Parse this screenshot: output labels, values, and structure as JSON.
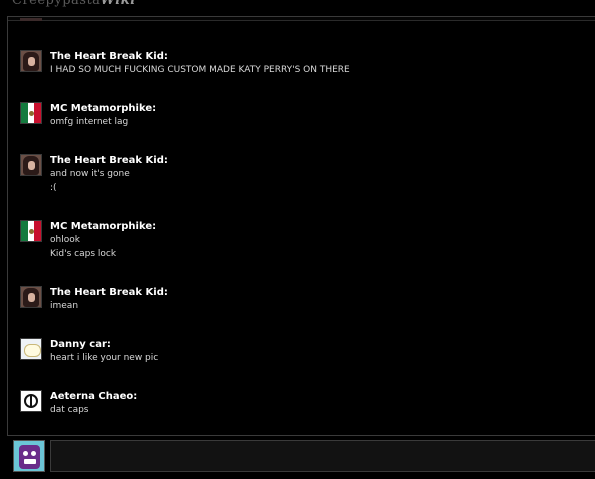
{
  "header": {
    "logo_prefix": "Creepypasta",
    "logo_suffix": "Wiki"
  },
  "chat": {
    "messages": [
      {
        "user": "The Heart Break Kid:",
        "avatar": "woman-photo-avatar",
        "lines": [
          "I HAD SO MUCH FUCKING CUSTOM MADE KATY PERRY'S ON THERE"
        ]
      },
      {
        "user": "MC Metamorphike:",
        "avatar": "mexico-flag-avatar",
        "lines": [
          "omfg internet lag"
        ]
      },
      {
        "user": "The Heart Break Kid:",
        "avatar": "woman-photo-avatar",
        "lines": [
          "and now it's gone",
          ":("
        ]
      },
      {
        "user": "MC Metamorphike:",
        "avatar": "mexico-flag-avatar",
        "lines": [
          "ohlook",
          "Kid's caps lock"
        ]
      },
      {
        "user": "The Heart Break Kid:",
        "avatar": "woman-photo-avatar",
        "lines": [
          "imean"
        ]
      },
      {
        "user": "Danny car:",
        "avatar": "cartoon-blob-avatar",
        "lines": [
          "heart i like your new pic"
        ]
      },
      {
        "user": "Aeterna Chaeo:",
        "avatar": "clock-symbol-avatar",
        "lines": [
          "dat caps"
        ]
      }
    ]
  },
  "input": {
    "value": "",
    "placeholder": ""
  },
  "colors": {
    "background": "#000000",
    "text": "#d8d8d8",
    "username": "#ffffff",
    "border": "#3a3a3a"
  }
}
